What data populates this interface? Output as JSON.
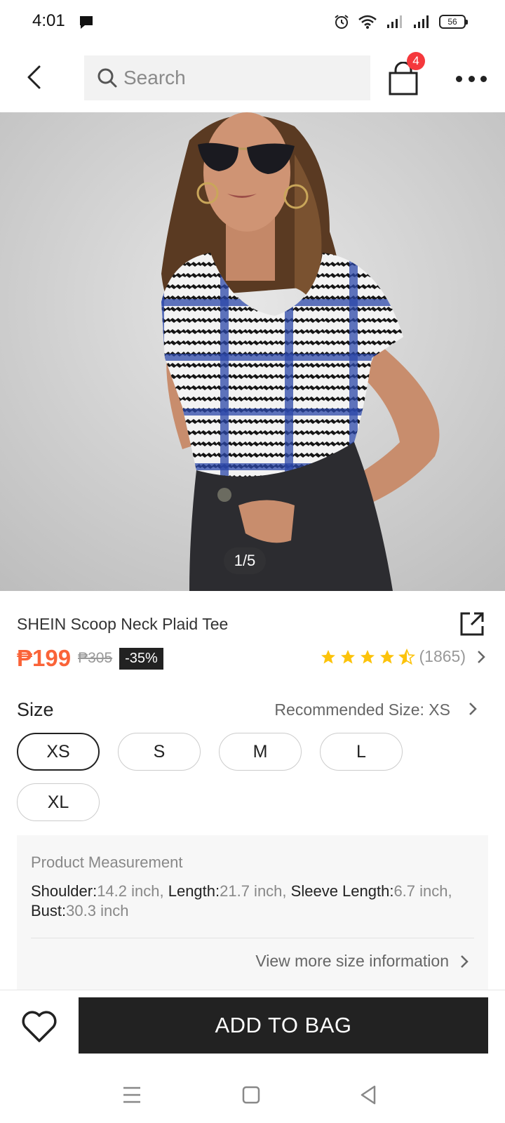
{
  "status_bar": {
    "time": "4:01",
    "battery": "56"
  },
  "top_nav": {
    "search_placeholder": "Search",
    "bag_count": "4"
  },
  "gallery": {
    "counter": "1/5"
  },
  "product": {
    "title": "SHEIN Scoop Neck Plaid Tee",
    "price": "₱199",
    "original_price": "₱305",
    "discount": "-35%",
    "rating": 4.5,
    "review_count": "(1865)"
  },
  "size": {
    "label": "Size",
    "recommended": "Recommended Size: XS",
    "options": [
      "XS",
      "S",
      "M",
      "L",
      "XL"
    ],
    "selected": "XS"
  },
  "measurement": {
    "title": "Product Measurement",
    "shoulder_label": "Shoulder:",
    "shoulder_value": "14.2 inch,",
    "length_label": "Length:",
    "length_value": "21.7 inch,",
    "sleeve_label": "Sleeve Length:",
    "sleeve_value": "6.7 inch,",
    "bust_label": "Bust:",
    "bust_value": "30.3 inch",
    "view_more": "View more size information"
  },
  "actions": {
    "add_to_bag": "ADD TO BAG"
  },
  "colors": {
    "price": "#fa6338",
    "badge": "#f5383c",
    "star": "#fcc30b",
    "dark": "#222222"
  }
}
